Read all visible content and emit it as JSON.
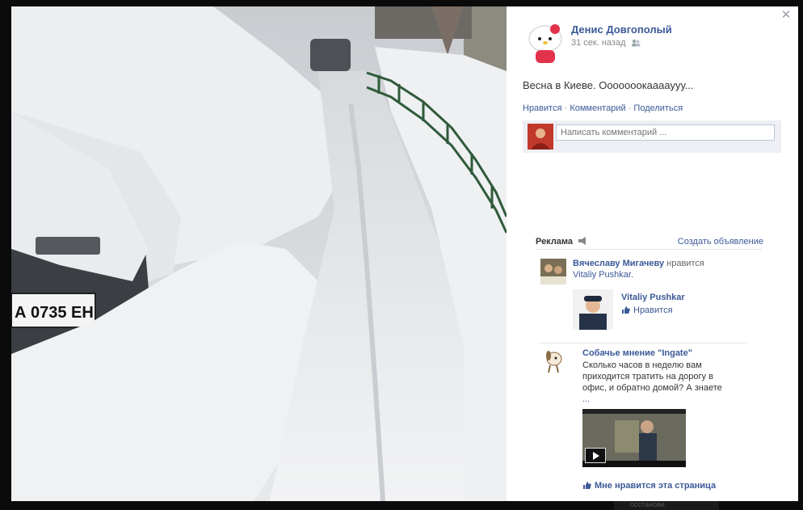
{
  "post": {
    "author": "Денис Довгополый",
    "time": "31 сек. назад",
    "text": "Весна в Киеве. Ооооооокааааууу...",
    "actions": {
      "like": "Нравится",
      "comment": "Комментарий",
      "share": "Поделиться",
      "separator": " · "
    },
    "comment_placeholder": "Написать комментарий ..."
  },
  "photo": {
    "plate_text": "А 0735 ЕН"
  },
  "ads": {
    "title": "Реклама",
    "create": "Создать объявление",
    "ad1": {
      "who": "Вячеславу Мигачеву",
      "verb": " нравится",
      "target": "Vitaliy Pushkar.",
      "card_name": "Vitaliy Pushkar",
      "card_like": "Нравится"
    },
    "ad2": {
      "title": "Собачье мнение \"Ingate\"",
      "body": "Сколько часов в неделю вам приходится тратить на дорогу в офис, и обратно домой? А знаете",
      "more": " ...",
      "like": "Мне нравится эта страница"
    }
  },
  "backdrop": {
    "text": "осстанови"
  },
  "icons": {
    "close": "close-icon",
    "audience": "friends-icon",
    "megaphone": "megaphone-icon",
    "thumb": "thumbs-up-icon",
    "play": "play-icon"
  },
  "colors": {
    "link": "#3b5998",
    "comment_bg": "#edeff4"
  }
}
